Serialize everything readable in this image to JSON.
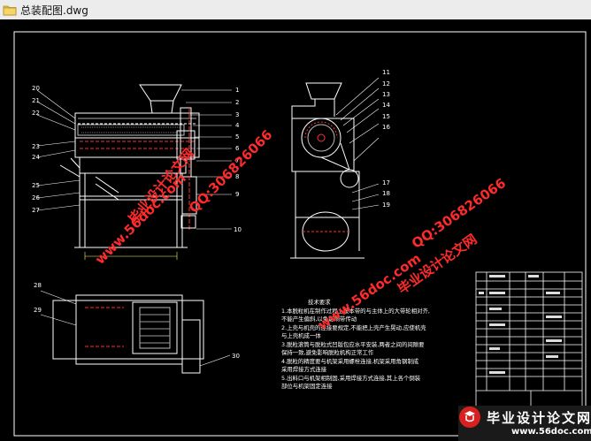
{
  "window": {
    "title": "总装配图.dwg",
    "file_icon": "folder-icon"
  },
  "drawing": {
    "part_numbers_left_top": [
      "1",
      "2",
      "3",
      "4",
      "5",
      "6",
      "7",
      "8",
      "9",
      "10"
    ],
    "part_numbers_left_side": [
      "20",
      "21",
      "22",
      "23",
      "24",
      "25",
      "26",
      "27"
    ],
    "part_numbers_right": [
      "11",
      "12",
      "13",
      "14",
      "15",
      "16",
      "17",
      "18",
      "19"
    ],
    "part_numbers_plan": [
      "28",
      "29",
      "30"
    ],
    "notes": {
      "heading": "技术要求",
      "lines": [
        "1.本脱粒机在制作过程上按本带的与主体上的大带轮相对齐,",
        "  不能产生偏斜,以免影响带传动",
        "2.上壳与机壳的连接要规定,不能把上壳产生晃动,应使机壳",
        "  与上壳机成一体",
        "3.脱粒滚筒与脱粒式凹版包应水平安装,两者之间的间隙要",
        "  保持一致,避免影响脱粒机构正常工作",
        "4.脱粒的精度要与机架采用螺栓连接,机架采用角钢制成",
        "  采用焊接方式连接",
        "5.出料口与机架相制固,采用焊接方式连接,其上各个倒装",
        "  部位与机架固定连接"
      ]
    }
  },
  "watermarks": [
    {
      "text": "毕业设计论文网",
      "color": "red"
    },
    {
      "text": "www.56doc.com",
      "color": "red"
    },
    {
      "text": "QQ:306826066",
      "color": "red"
    },
    {
      "text": "www.56doc.com",
      "color": "red"
    },
    {
      "text": "QQ:306826066",
      "color": "red"
    },
    {
      "text": "毕业设计论文网",
      "color": "red"
    }
  ],
  "brand": {
    "title": "毕业设计论文网",
    "url": "www.56doc.com",
    "logo_icon": "brand-logo-icon"
  },
  "colors": {
    "background": "#000000",
    "line_primary": "#ffffff",
    "line_hidden": "#ff3030",
    "line_dim": "#ffff66",
    "watermark_red": "#ff2b2b"
  }
}
